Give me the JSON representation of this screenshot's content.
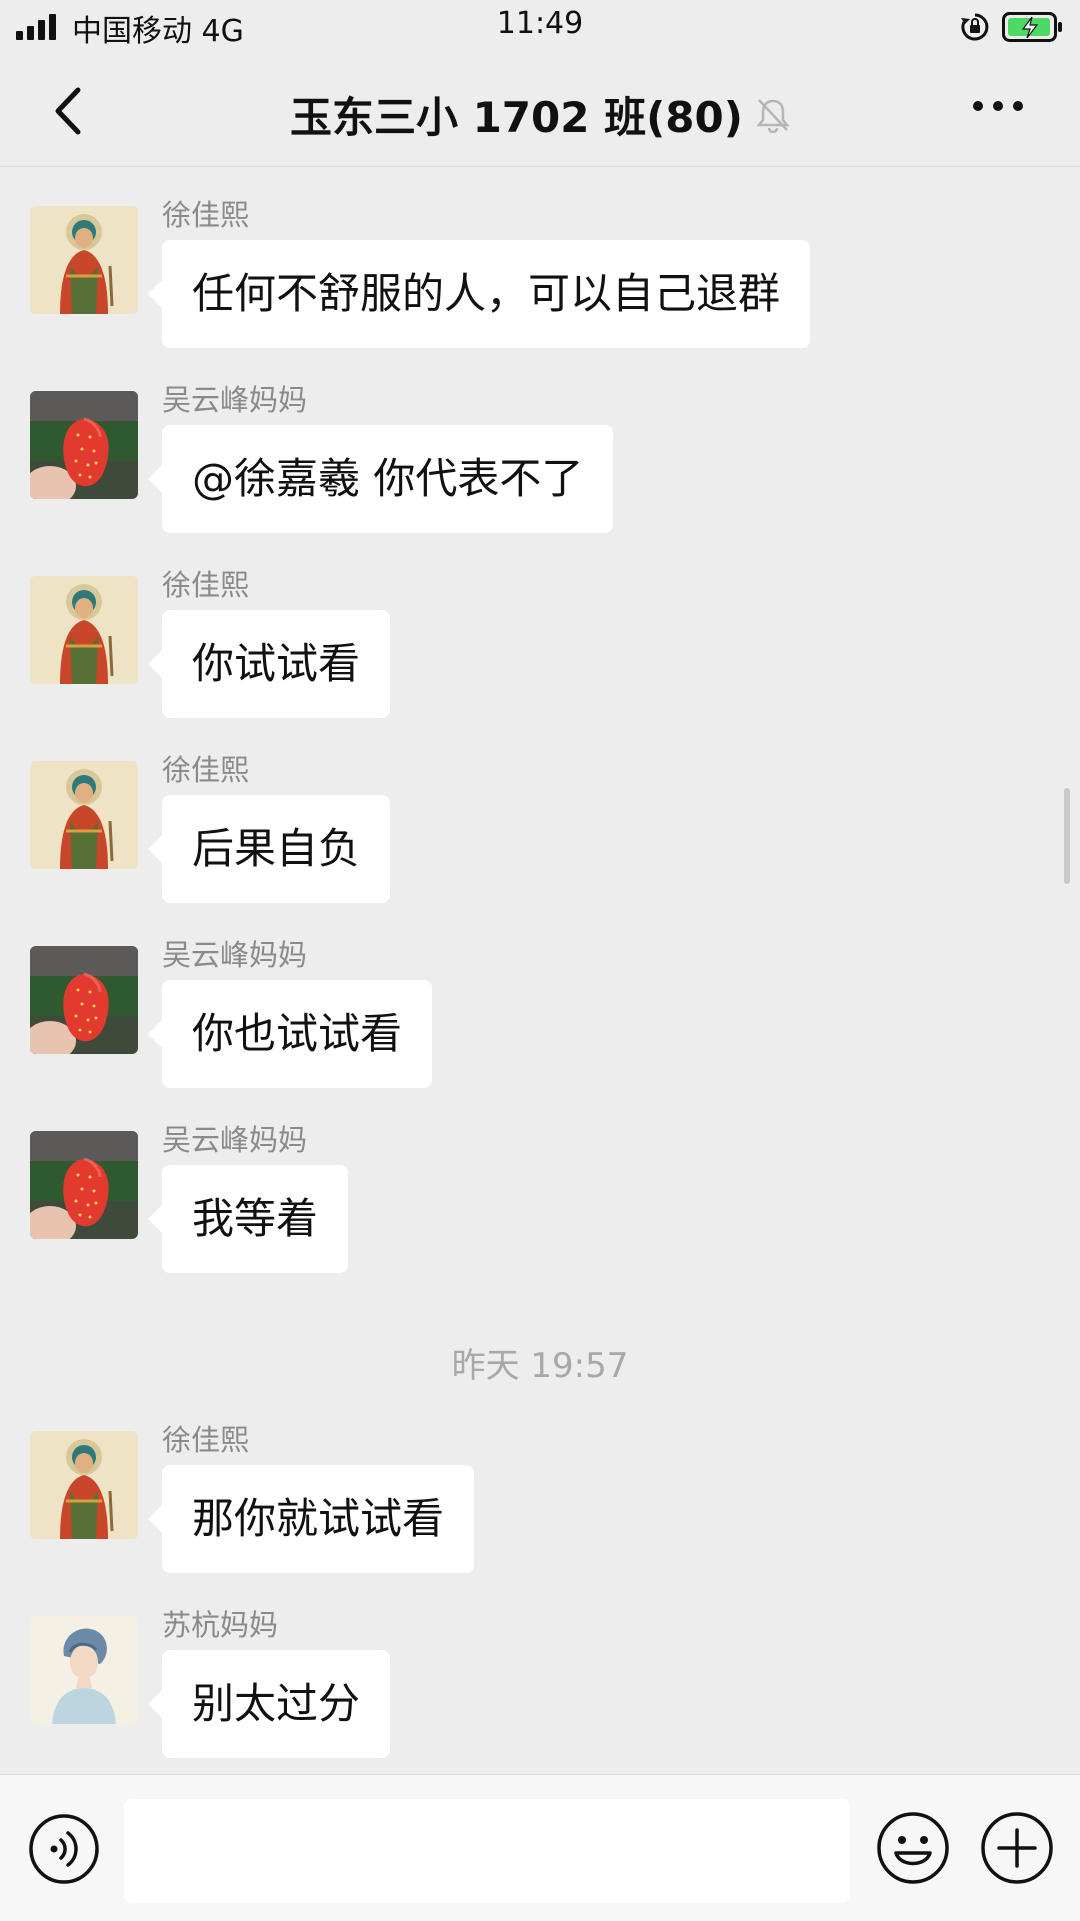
{
  "status_bar": {
    "carrier": "中国移动 4G",
    "time": "11:49"
  },
  "header": {
    "title": "玉东三小 1702 班(80)"
  },
  "messages": [
    {
      "sender": "徐佳熙",
      "text": "任何不舒服的人，可以自己退群",
      "avatar": "buddha-portrait"
    },
    {
      "sender": "吴云峰妈妈",
      "text": "@徐嘉羲 你代表不了",
      "avatar": "strawberry"
    },
    {
      "sender": "徐佳熙",
      "text": "你试试看",
      "avatar": "buddha-portrait"
    },
    {
      "sender": "徐佳熙",
      "text": "后果自负",
      "avatar": "buddha-portrait"
    },
    {
      "sender": "吴云峰妈妈",
      "text": "你也试试看",
      "avatar": "strawberry"
    },
    {
      "sender": "吴云峰妈妈",
      "text": "我等着",
      "avatar": "strawberry"
    },
    {
      "sender": "徐佳熙",
      "text": "那你就试试看",
      "avatar": "buddha-portrait"
    },
    {
      "sender": "苏杭妈妈",
      "text": "别太过分",
      "avatar": "lady-portrait"
    }
  ],
  "time_divider": "昨天 19:57",
  "input_bar": {
    "input_value": "",
    "icons": [
      "voice-icon",
      "emoji-icon",
      "plus-icon"
    ]
  },
  "colors": {
    "background": "#ededed",
    "bubble": "#ffffff",
    "sender_name": "#8a8a8a",
    "battery_green": "#4cd964"
  }
}
